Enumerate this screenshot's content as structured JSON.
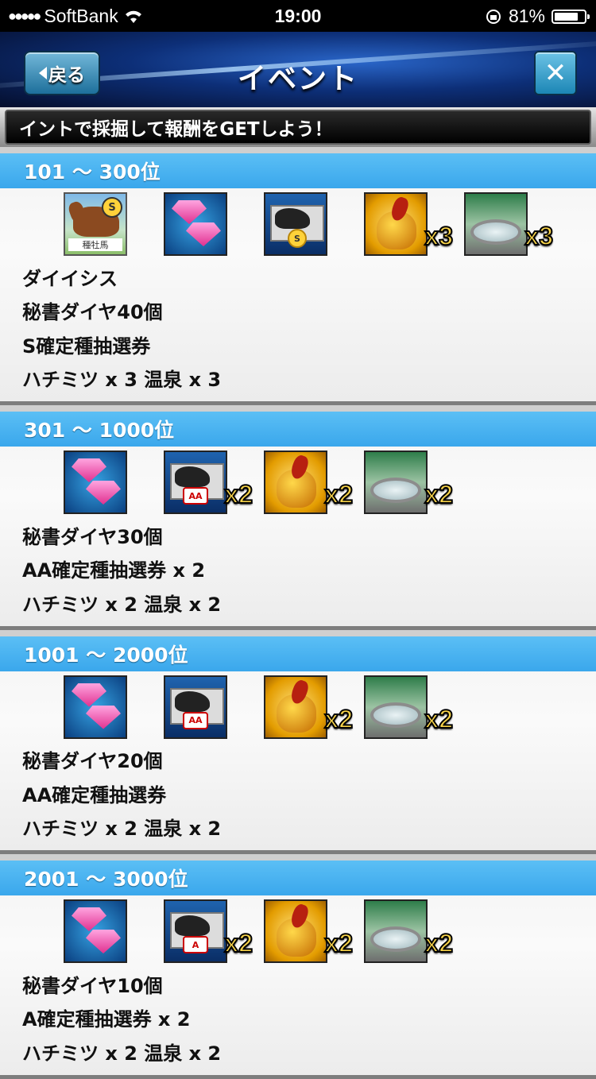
{
  "statusbar": {
    "signal": "●●●●●",
    "carrier": "SoftBank",
    "wifi": "wifi-icon",
    "time": "19:00",
    "battery_pct": "81%",
    "battery_level": 0.81
  },
  "header": {
    "back_label": "戻る",
    "title": "イベント",
    "close_label": "✕"
  },
  "marquee": {
    "text": "イントで採掘して報酬をGETしよう！"
  },
  "sections": [
    {
      "rank": "101 〜 300位",
      "icons": [
        {
          "type": "horse",
          "badge": "S",
          "label": "種牡馬",
          "qty": ""
        },
        {
          "type": "diamond",
          "qty": ""
        },
        {
          "type": "ticket",
          "rank": "S",
          "qty": ""
        },
        {
          "type": "honey",
          "qty": "x3"
        },
        {
          "type": "onsen",
          "qty": "x3"
        }
      ],
      "lines": [
        "ダイイシス",
        "秘書ダイヤ40個",
        "S確定種抽選券",
        "ハチミツ x 3 温泉 x 3"
      ]
    },
    {
      "rank": "301 〜 1000位",
      "icons": [
        {
          "type": "diamond",
          "qty": ""
        },
        {
          "type": "ticket",
          "rank": "AA",
          "qty": "x2"
        },
        {
          "type": "honey",
          "qty": "x2"
        },
        {
          "type": "onsen",
          "qty": "x2"
        }
      ],
      "lines": [
        "秘書ダイヤ30個",
        "AA確定種抽選券 x 2",
        "ハチミツ x 2 温泉 x 2"
      ]
    },
    {
      "rank": "1001 〜 2000位",
      "icons": [
        {
          "type": "diamond",
          "qty": ""
        },
        {
          "type": "ticket",
          "rank": "AA",
          "qty": ""
        },
        {
          "type": "honey",
          "qty": "x2"
        },
        {
          "type": "onsen",
          "qty": "x2"
        }
      ],
      "lines": [
        "秘書ダイヤ20個",
        "AA確定種抽選券",
        "ハチミツ x 2 温泉 x 2"
      ]
    },
    {
      "rank": "2001 〜 3000位",
      "icons": [
        {
          "type": "diamond",
          "qty": ""
        },
        {
          "type": "ticket",
          "rank": "A",
          "qty": "x2"
        },
        {
          "type": "honey",
          "qty": "x2"
        },
        {
          "type": "onsen",
          "qty": "x2"
        }
      ],
      "lines": [
        "秘書ダイヤ10個",
        "A確定種抽選券 x 2",
        "ハチミツ x 2 温泉 x 2"
      ]
    }
  ],
  "colors": {
    "section_head": "#3aa7ec",
    "header_dark": "#050e2c",
    "qty_gold": "#f7d34a"
  }
}
